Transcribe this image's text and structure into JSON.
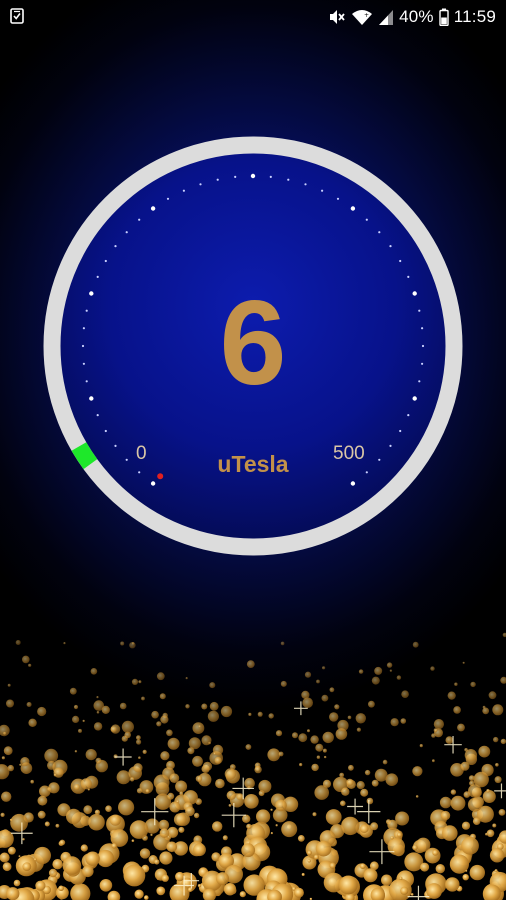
{
  "status_bar": {
    "battery": "40%",
    "time": "11:59",
    "icons": [
      "sim-toolkit-icon",
      "mute-icon",
      "wifi-icon",
      "signal-icon",
      "battery-icon"
    ]
  },
  "gauge": {
    "value": "6",
    "unit": "uTesla",
    "scale_min": "0",
    "scale_max": "500",
    "fill_fraction": 0.012,
    "colors": {
      "ring": "#dcdcdc",
      "indicator": "#1ee82a",
      "needle_dot": "#e02020",
      "text": "#c2914a",
      "dial_background": "#0b1aa0"
    }
  },
  "decoration": {
    "background": "gold-sparkle-bokeh",
    "colors": [
      "#f3c35a",
      "#d89a34",
      "#fde7a0"
    ]
  }
}
